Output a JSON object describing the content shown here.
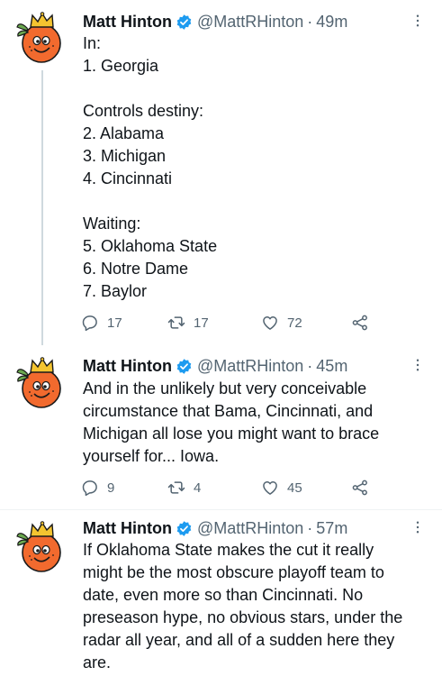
{
  "tweets": [
    {
      "author": {
        "name": "Matt Hinton",
        "handle": "@MattRHinton"
      },
      "time": "49m",
      "lines": [
        "In:",
        "1. Georgia",
        "",
        "Controls destiny:",
        "2. Alabama",
        "3. Michigan",
        "4. Cincinnati",
        "",
        "Waiting:",
        "5. Oklahoma State",
        "6. Notre Dame",
        "7. Baylor"
      ],
      "replies": "17",
      "retweets": "17",
      "likes": "72"
    },
    {
      "author": {
        "name": "Matt Hinton",
        "handle": "@MattRHinton"
      },
      "time": "45m",
      "lines": [
        "And in the unlikely but very conceivable",
        "circumstance that Bama, Cincinnati, and",
        "Michigan all lose you might want to brace",
        "yourself for... Iowa."
      ],
      "replies": "9",
      "retweets": "4",
      "likes": "45"
    },
    {
      "author": {
        "name": "Matt Hinton",
        "handle": "@MattRHinton"
      },
      "time": "57m",
      "lines": [
        "If Oklahoma State makes the cut it really",
        "might be the most obscure playoff team to",
        "date, even more so than Cincinnati. No",
        "preseason hype, no obvious stars, under the",
        "radar all year, and all of a sudden here they",
        "are."
      ]
    }
  ],
  "colors": {
    "text": "#0f1419",
    "secondary": "#536471",
    "verified": "#1d9bf0",
    "thread_line": "#cfd9de"
  },
  "icons": [
    "verified-badge-icon",
    "more-icon",
    "reply-icon",
    "retweet-icon",
    "like-icon",
    "share-icon"
  ]
}
